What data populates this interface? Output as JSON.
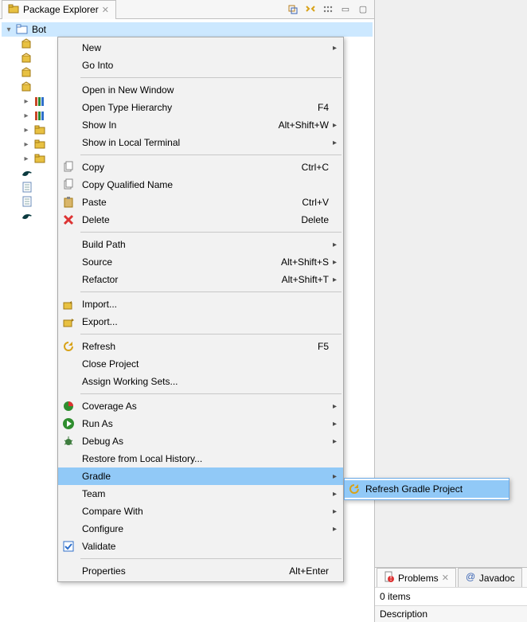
{
  "view": {
    "title": "Package Explorer",
    "toolbar": {
      "collapse": "collapse-all",
      "link": "link-with-editor",
      "menu": "view-menu",
      "minimize": "min",
      "maximize": "max"
    }
  },
  "project": {
    "name": "Bot"
  },
  "context_menu": {
    "groups": [
      [
        {
          "id": "new",
          "label": "New",
          "sub": true
        },
        {
          "id": "go_into",
          "label": "Go Into"
        }
      ],
      [
        {
          "id": "open_new_window",
          "label": "Open in New Window"
        },
        {
          "id": "open_type_hierarchy",
          "label": "Open Type Hierarchy",
          "accel": "F4"
        },
        {
          "id": "show_in",
          "label": "Show In",
          "accel": "Alt+Shift+W",
          "sub": true
        },
        {
          "id": "show_local_terminal",
          "label": "Show in Local Terminal",
          "sub": true
        }
      ],
      [
        {
          "id": "copy",
          "label": "Copy",
          "accel": "Ctrl+C",
          "icon": "copy"
        },
        {
          "id": "copy_qname",
          "label": "Copy Qualified Name",
          "icon": "copy"
        },
        {
          "id": "paste",
          "label": "Paste",
          "accel": "Ctrl+V",
          "icon": "paste"
        },
        {
          "id": "delete",
          "label": "Delete",
          "accel": "Delete",
          "icon": "delete"
        }
      ],
      [
        {
          "id": "build_path",
          "label": "Build Path",
          "sub": true
        },
        {
          "id": "source",
          "label": "Source",
          "accel": "Alt+Shift+S",
          "sub": true
        },
        {
          "id": "refactor",
          "label": "Refactor",
          "accel": "Alt+Shift+T",
          "sub": true
        }
      ],
      [
        {
          "id": "import",
          "label": "Import...",
          "icon": "import"
        },
        {
          "id": "export",
          "label": "Export...",
          "icon": "export"
        }
      ],
      [
        {
          "id": "refresh",
          "label": "Refresh",
          "accel": "F5",
          "icon": "refresh"
        },
        {
          "id": "close_project",
          "label": "Close Project"
        },
        {
          "id": "assign_ws",
          "label": "Assign Working Sets..."
        }
      ],
      [
        {
          "id": "coverage_as",
          "label": "Coverage As",
          "icon": "coverage",
          "sub": true
        },
        {
          "id": "run_as",
          "label": "Run As",
          "icon": "run",
          "sub": true
        },
        {
          "id": "debug_as",
          "label": "Debug As",
          "icon": "debug",
          "sub": true
        },
        {
          "id": "restore_history",
          "label": "Restore from Local History..."
        },
        {
          "id": "gradle",
          "label": "Gradle",
          "sub": true,
          "highlight": true
        },
        {
          "id": "team",
          "label": "Team",
          "sub": true
        },
        {
          "id": "compare_with",
          "label": "Compare With",
          "sub": true
        },
        {
          "id": "configure",
          "label": "Configure",
          "sub": true
        },
        {
          "id": "validate",
          "label": "Validate",
          "icon": "validate"
        }
      ],
      [
        {
          "id": "properties",
          "label": "Properties",
          "accel": "Alt+Enter"
        }
      ]
    ]
  },
  "gradle_submenu": {
    "items": [
      {
        "id": "refresh_gradle_project",
        "label": "Refresh Gradle Project",
        "icon": "refresh"
      }
    ]
  },
  "right_panel": {
    "tabs": {
      "problems": "Problems",
      "javadoc": "Javadoc"
    },
    "items_count": "0 items",
    "table_header": "Description"
  }
}
